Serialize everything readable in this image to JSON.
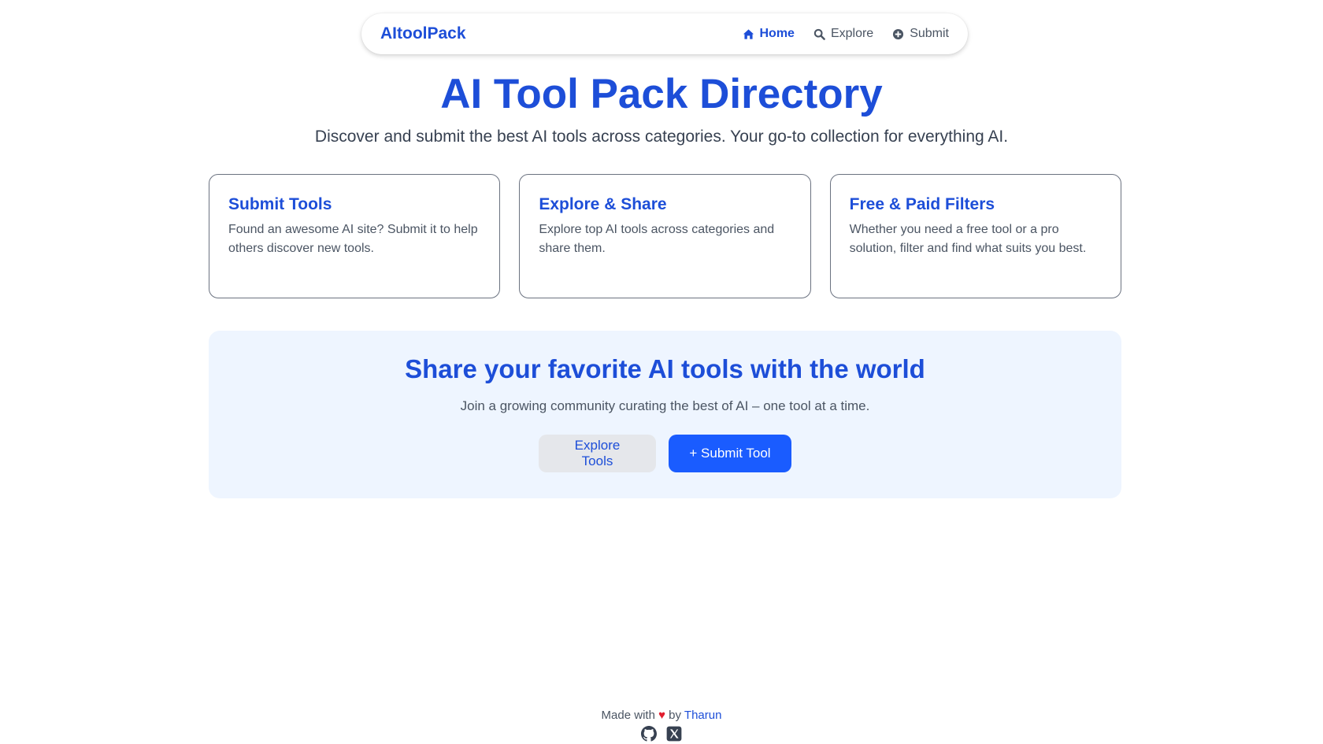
{
  "nav": {
    "brand": "AItoolPack",
    "links": [
      {
        "label": "Home",
        "icon": "home-icon",
        "active": true
      },
      {
        "label": "Explore",
        "icon": "search-icon",
        "active": false
      },
      {
        "label": "Submit",
        "icon": "plus-circle-icon",
        "active": false
      }
    ]
  },
  "hero": {
    "title": "AI Tool Pack Directory",
    "subtitle": "Discover and submit the best AI tools across categories. Your go-to collection for everything AI."
  },
  "features": [
    {
      "title": "Submit Tools",
      "text": "Found an awesome AI site? Submit it to help others discover new tools."
    },
    {
      "title": "Explore & Share",
      "text": "Explore top AI tools across categories and share them."
    },
    {
      "title": "Free & Paid Filters",
      "text": "Whether you need a free tool or a pro solution, filter and find what suits you best."
    }
  ],
  "cta": {
    "title": "Share your favorite AI tools with the world",
    "text": "Join a growing community curating the best of AI – one tool at a time.",
    "explore_label": "Explore Tools",
    "submit_label": "+ Submit Tool"
  },
  "footer": {
    "made_with": "Made with",
    "heart": "♥",
    "by": "by",
    "author": "Tharun",
    "icons": [
      "github-icon",
      "x-icon"
    ]
  },
  "colors": {
    "brand": "#1d4ed8",
    "primary_button": "#1a5cff",
    "cta_background": "#eef5ff",
    "heart": "#e11d2e"
  }
}
